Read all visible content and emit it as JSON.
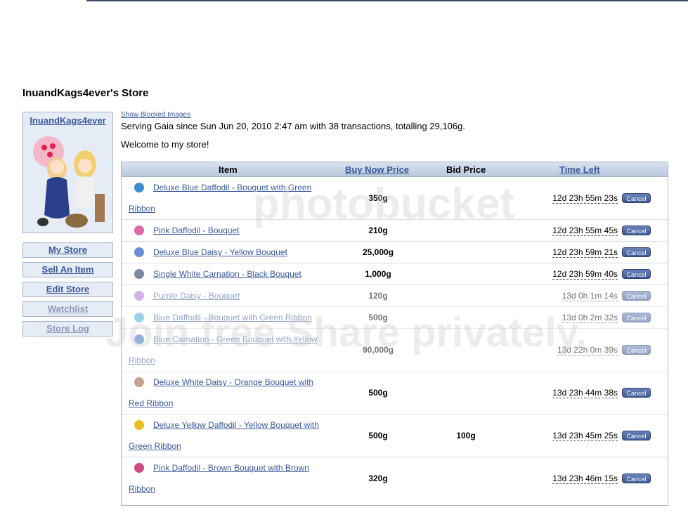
{
  "store": {
    "title": "InuandKags4ever's Store",
    "owner": "InuandKags4ever",
    "show_blocked": "Show Blocked Images",
    "serving": "Serving Gaia since Sun Jun 20, 2010 2:47 am with 38 transactions, totalling 29,106g.",
    "welcome": "Welcome to my store!"
  },
  "nav": [
    {
      "label": "My Store"
    },
    {
      "label": "Sell An Item"
    },
    {
      "label": "Edit Store"
    },
    {
      "label": "Watchlist"
    },
    {
      "label": "Store Log"
    }
  ],
  "table": {
    "headers": {
      "item": "Item",
      "buy_now": "Buy Now Price",
      "bid": "Bid Price",
      "time_left": "Time Left"
    },
    "cancel_label": "Cancel",
    "rows": [
      {
        "item": "Deluxe Blue Daffodil - Bouquet with Green Ribbon",
        "price": "350g",
        "bid": "",
        "time": "12d 23h 55m 23s",
        "icon_color": "#3a8fd0"
      },
      {
        "item": "Pink Daffodil - Bouquet",
        "price": "210g",
        "bid": "",
        "time": "12d 23h 55m 45s",
        "icon_color": "#e06aa8"
      },
      {
        "item": "Deluxe Blue Daisy - Yellow Bouquet",
        "price": "25,000g",
        "bid": "",
        "time": "12d 23h 59m 21s",
        "icon_color": "#6a8fd8"
      },
      {
        "item": "Single White Carnation - Black Bouquet",
        "price": "1,000g",
        "bid": "",
        "time": "12d 23h 59m 40s",
        "icon_color": "#7a8aa0"
      },
      {
        "item": "Purple Daisy - Bouquet",
        "price": "120g",
        "bid": "",
        "time": "13d 0h 1m 14s",
        "icon_color": "#b070d0"
      },
      {
        "item": "Blue Daffodil - Bouquet with Green Ribbon",
        "price": "500g",
        "bid": "",
        "time": "13d 0h 2m 32s",
        "icon_color": "#4ab0d8"
      },
      {
        "item": "Blue Carnation - Green Bouquet with Yellow Ribbon",
        "price": "90,000g",
        "bid": "",
        "time": "13d 22h 0m 39s",
        "icon_color": "#3a70c0"
      },
      {
        "item": "Deluxe White Daisy - Orange Bouquet with Red Ribbon",
        "price": "500g",
        "bid": "",
        "time": "13d 23h 44m 38s",
        "icon_color": "#c8a090"
      },
      {
        "item": "Deluxe Yellow Daffodil - Yellow Bouquet with Green Ribbon",
        "price": "500g",
        "bid": "100g",
        "time": "13d 23h 45m 25s",
        "icon_color": "#e8c020"
      },
      {
        "item": "Pink Daffodil - Brown Bouquet with Brown Ribbon",
        "price": "320g",
        "bid": "",
        "time": "13d 23h 46m 15s",
        "icon_color": "#d04a80"
      }
    ]
  },
  "watermark": {
    "line1": "photobucket",
    "line2": "Join free Share privately."
  }
}
